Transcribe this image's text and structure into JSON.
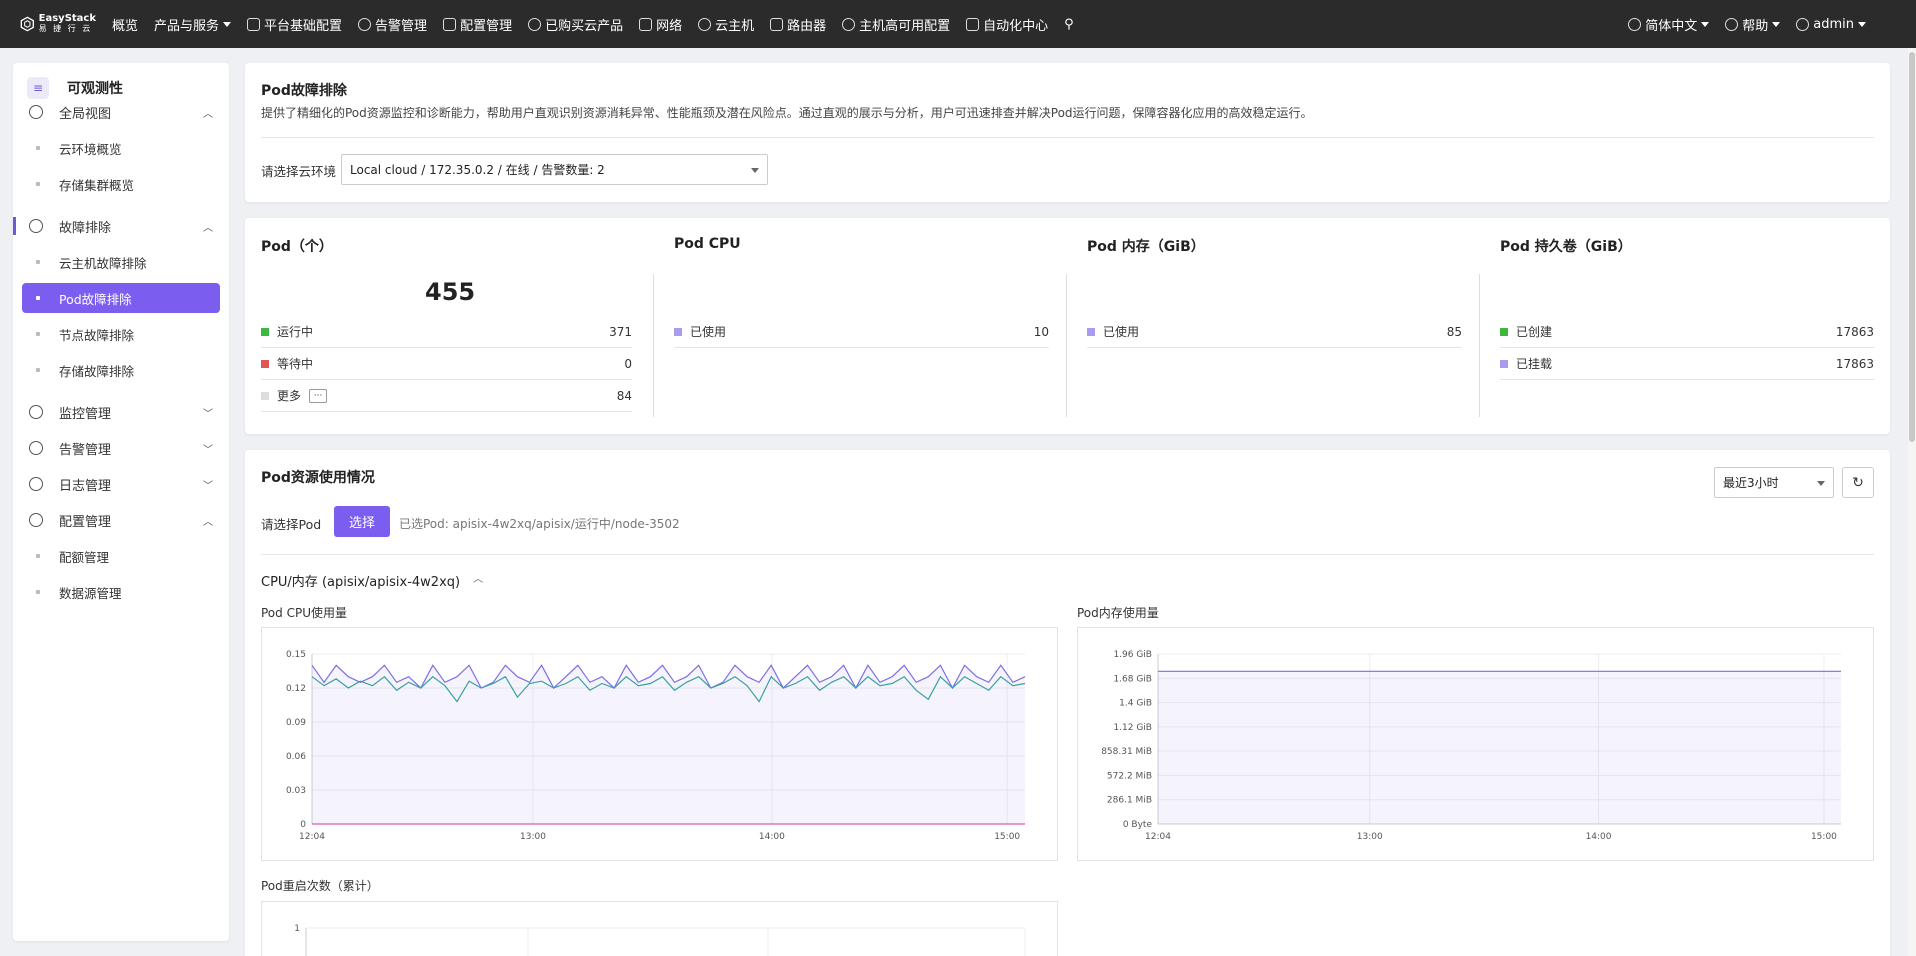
{
  "topnav": {
    "logo_line1": "EasyStack",
    "logo_line2": "易 捷 行 云",
    "items": [
      {
        "label": "概览",
        "icon": "",
        "caret": false
      },
      {
        "label": "产品与服务",
        "icon": "",
        "caret": true
      },
      {
        "label": "平台基础配置",
        "icon": "gear-icon",
        "caret": false
      },
      {
        "label": "告警管理",
        "icon": "bell-icon",
        "caret": false
      },
      {
        "label": "配置管理",
        "icon": "gear-icon",
        "caret": false
      },
      {
        "label": "已购买云产品",
        "icon": "list-icon",
        "caret": false
      },
      {
        "label": "网络",
        "icon": "network-icon",
        "caret": false
      },
      {
        "label": "云主机",
        "icon": "cloud-icon",
        "caret": false
      },
      {
        "label": "路由器",
        "icon": "router-icon",
        "caret": false
      },
      {
        "label": "主机高可用配置",
        "icon": "server-icon",
        "caret": false
      },
      {
        "label": "自动化中心",
        "icon": "automation-icon",
        "caret": false
      }
    ],
    "language": "简体中文",
    "help": "帮助",
    "user": "admin"
  },
  "sidebar": {
    "title": "可观测性",
    "title_icon": "≡",
    "groups": [
      {
        "label": "全局视图",
        "icon": "globe-icon",
        "expanded": true,
        "items": [
          "云环境概览",
          "存储集群概览"
        ]
      },
      {
        "label": "故障排除",
        "icon": "diagnose-icon",
        "expanded": true,
        "items": [
          "云主机故障排除",
          "Pod故障排除",
          "节点故障排除",
          "存储故障排除"
        ]
      },
      {
        "label": "监控管理",
        "icon": "monitor-icon",
        "expanded": false,
        "items": []
      },
      {
        "label": "告警管理",
        "icon": "alarm-icon",
        "expanded": false,
        "items": []
      },
      {
        "label": "日志管理",
        "icon": "log-icon",
        "expanded": false,
        "items": []
      },
      {
        "label": "配置管理",
        "icon": "config-icon",
        "expanded": true,
        "items": [
          "配额管理",
          "数据源管理"
        ]
      }
    ],
    "active_item": "Pod故障排除"
  },
  "header": {
    "title": "Pod故障排除",
    "description": "提供了精细化的Pod资源监控和诊断能力，帮助用户直观识别资源消耗异常、性能瓶颈及潜在风险点。通过直观的展示与分析，用户可迅速排查并解决Pod运行问题，保障容器化应用的高效稳定运行。",
    "env_label": "请选择云环境",
    "env_value": "Local cloud / 172.35.0.2 / 在线 / 告警数量: 2"
  },
  "stats": {
    "pod": {
      "title": "Pod（个）",
      "total": "455",
      "rows": [
        {
          "label": "运行中",
          "value": "371",
          "color": "#3cb93c"
        },
        {
          "label": "等待中",
          "value": "0",
          "color": "#e05555"
        },
        {
          "label": "更多",
          "value": "84",
          "color": "#dddddd"
        }
      ],
      "more_btn": "···"
    },
    "cpu": {
      "title": "Pod CPU",
      "rows": [
        {
          "label": "已使用",
          "value": "10",
          "color": "#a99cf0"
        }
      ]
    },
    "mem": {
      "title": "Pod 内存（GiB）",
      "rows": [
        {
          "label": "已使用",
          "value": "85",
          "color": "#a99cf0"
        }
      ]
    },
    "pv": {
      "title": "Pod 持久卷（GiB）",
      "rows": [
        {
          "label": "已创建",
          "value": "17863",
          "color": "#3cb93c"
        },
        {
          "label": "已挂载",
          "value": "17863",
          "color": "#a99cf0"
        }
      ]
    }
  },
  "resource": {
    "title": "Pod资源使用情况",
    "time_range": "最近3小时",
    "select_label": "请选择Pod",
    "select_button": "选择",
    "selected_pod": "已选Pod:  apisix-4w2xq/apisix/运行中/node-3502",
    "section_title": "CPU/内存 (apisix/apisix-4w2xq)",
    "cpu_chart_title": "Pod CPU使用量",
    "mem_chart_title": "Pod内存使用量",
    "restart_chart_title": "Pod重启次数（累计）"
  },
  "chart_data": [
    {
      "type": "line",
      "title": "Pod CPU使用量",
      "x_ticks": [
        "12:04",
        "13:00",
        "14:00",
        "15:00"
      ],
      "y_ticks": [
        "0",
        "0.03",
        "0.06",
        "0.09",
        "0.12",
        "0.15"
      ],
      "ylim": [
        0,
        0.15
      ],
      "series": [
        {
          "color": "#7b6ee8",
          "values": [
            0.14,
            0.125,
            0.14,
            0.13,
            0.125,
            0.13,
            0.14,
            0.125,
            0.13,
            0.12,
            0.14,
            0.125,
            0.13,
            0.14,
            0.12,
            0.125,
            0.14,
            0.13,
            0.125,
            0.14,
            0.12,
            0.13,
            0.14,
            0.125,
            0.13,
            0.12,
            0.14,
            0.125,
            0.13,
            0.14,
            0.125,
            0.13,
            0.14,
            0.12,
            0.125,
            0.14,
            0.13,
            0.125,
            0.14,
            0.12,
            0.13,
            0.14,
            0.125,
            0.13,
            0.14,
            0.12,
            0.14,
            0.125,
            0.13,
            0.14,
            0.125,
            0.13,
            0.14,
            0.12,
            0.14,
            0.13,
            0.125,
            0.14,
            0.125,
            0.13
          ]
        },
        {
          "color": "#3aa0a0",
          "values": [
            0.13,
            0.122,
            0.128,
            0.12,
            0.126,
            0.122,
            0.13,
            0.118,
            0.125,
            0.12,
            0.13,
            0.122,
            0.108,
            0.126,
            0.12,
            0.124,
            0.13,
            0.112,
            0.124,
            0.126,
            0.12,
            0.124,
            0.13,
            0.118,
            0.124,
            0.12,
            0.13,
            0.122,
            0.124,
            0.13,
            0.118,
            0.125,
            0.13,
            0.12,
            0.124,
            0.13,
            0.122,
            0.108,
            0.13,
            0.12,
            0.124,
            0.13,
            0.118,
            0.125,
            0.13,
            0.12,
            0.13,
            0.122,
            0.124,
            0.13,
            0.118,
            0.11,
            0.13,
            0.12,
            0.13,
            0.124,
            0.118,
            0.13,
            0.122,
            0.124
          ]
        },
        {
          "color": "#e05ab0",
          "values": [
            0,
            0,
            0,
            0,
            0,
            0,
            0,
            0,
            0,
            0,
            0,
            0,
            0,
            0,
            0,
            0,
            0,
            0,
            0,
            0,
            0,
            0,
            0,
            0,
            0,
            0,
            0,
            0,
            0,
            0,
            0,
            0,
            0,
            0,
            0,
            0,
            0,
            0,
            0,
            0,
            0,
            0,
            0,
            0,
            0,
            0,
            0,
            0,
            0,
            0,
            0,
            0,
            0,
            0,
            0,
            0,
            0,
            0,
            0,
            0
          ]
        }
      ]
    },
    {
      "type": "line",
      "title": "Pod内存使用量",
      "x_ticks": [
        "12:04",
        "13:00",
        "14:00",
        "15:00"
      ],
      "y_ticks": [
        "0 Byte",
        "286.1 MiB",
        "572.2 MiB",
        "858.31 MiB",
        "1.12 GiB",
        "1.4 GiB",
        "1.68 GiB",
        "1.96 GiB"
      ],
      "ylim": [
        0,
        1.96
      ],
      "series": [
        {
          "color": "#7b6ee8",
          "values": [
            1.76,
            1.76,
            1.76,
            1.76,
            1.76
          ]
        }
      ]
    },
    {
      "type": "line",
      "title": "Pod重启次数（累计）",
      "x_ticks": [],
      "y_ticks": [
        "1"
      ],
      "ylim": [
        0,
        1
      ],
      "series": []
    }
  ]
}
